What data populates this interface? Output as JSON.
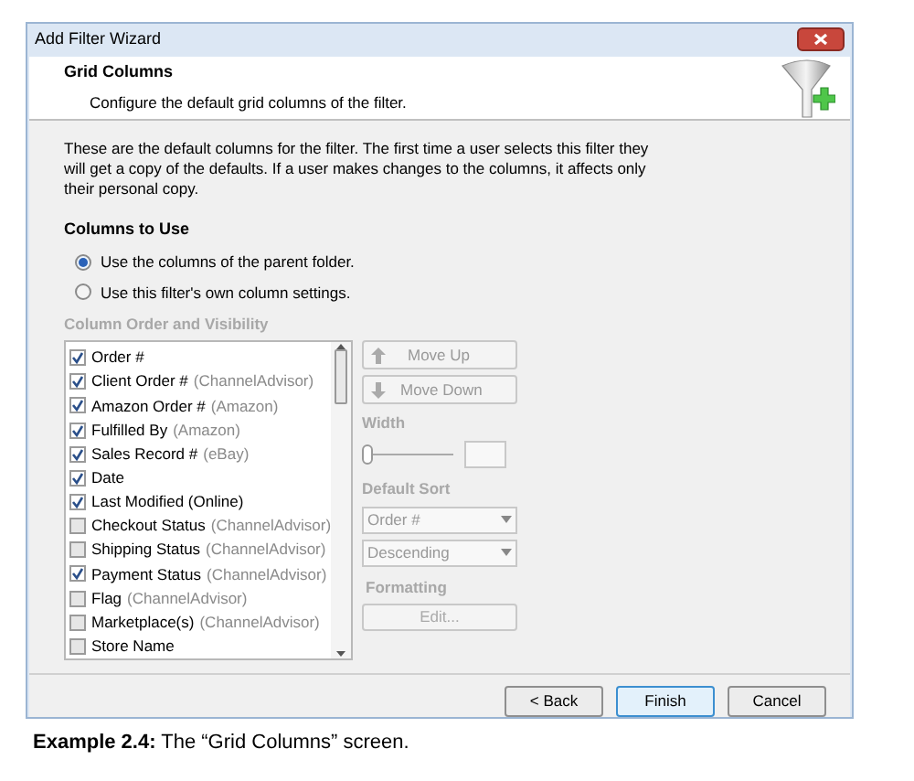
{
  "window": {
    "title": "Add Filter Wizard"
  },
  "header": {
    "title": "Grid Columns",
    "subtitle": "Configure the default grid columns of the filter."
  },
  "intro": "These are the default columns for the filter.  The first time a user selects this filter they will get a copy of the defaults.  If a user makes changes to the columns, it affects only their personal copy.",
  "columns_to_use": {
    "heading": "Columns to Use",
    "options": [
      {
        "label": "Use the columns of the parent folder.",
        "selected": true
      },
      {
        "label": "Use this filter's own column settings.",
        "selected": false
      }
    ]
  },
  "column_order": {
    "heading": "Column Order and Visibility",
    "items": [
      {
        "name": "Order #",
        "checked": true
      },
      {
        "name": "Client Order #",
        "source": "(ChannelAdvisor)",
        "checked": true
      },
      {
        "name": "Amazon Order #",
        "source": "(Amazon)",
        "checked": true
      },
      {
        "name": "Fulfilled By",
        "source": "(Amazon)",
        "checked": true
      },
      {
        "name": "Sales Record #",
        "source": "(eBay)",
        "checked": true
      },
      {
        "name": "Date",
        "checked": true
      },
      {
        "name": "Last Modified (Online)",
        "checked": true
      },
      {
        "name": "Checkout Status",
        "source": "(ChannelAdvisor)",
        "checked": false
      },
      {
        "name": "Shipping Status",
        "source": "(ChannelAdvisor)",
        "checked": false
      },
      {
        "name": "Payment Status",
        "source": "(ChannelAdvisor)",
        "checked": true
      },
      {
        "name": "Flag",
        "source": "(ChannelAdvisor)",
        "checked": false
      },
      {
        "name": "Marketplace(s)",
        "source": "(ChannelAdvisor)",
        "checked": false
      },
      {
        "name": "Store Name",
        "checked": false
      }
    ]
  },
  "move_up": "Move Up",
  "move_down": "Move Down",
  "width": {
    "label": "Width",
    "level": 0
  },
  "default_sort": {
    "label": "Default Sort",
    "column": "Order #",
    "direction": "Descending"
  },
  "formatting": {
    "label": "Formatting",
    "button": "Edit..."
  },
  "buttons": [
    {
      "label": "< Back",
      "selected": false
    },
    {
      "label": "Finish",
      "selected": true
    },
    {
      "label": "Cancel",
      "selected": false
    }
  ],
  "caption": {
    "label": "Example 2.4:",
    "text": "The “Grid Columns” screen."
  }
}
